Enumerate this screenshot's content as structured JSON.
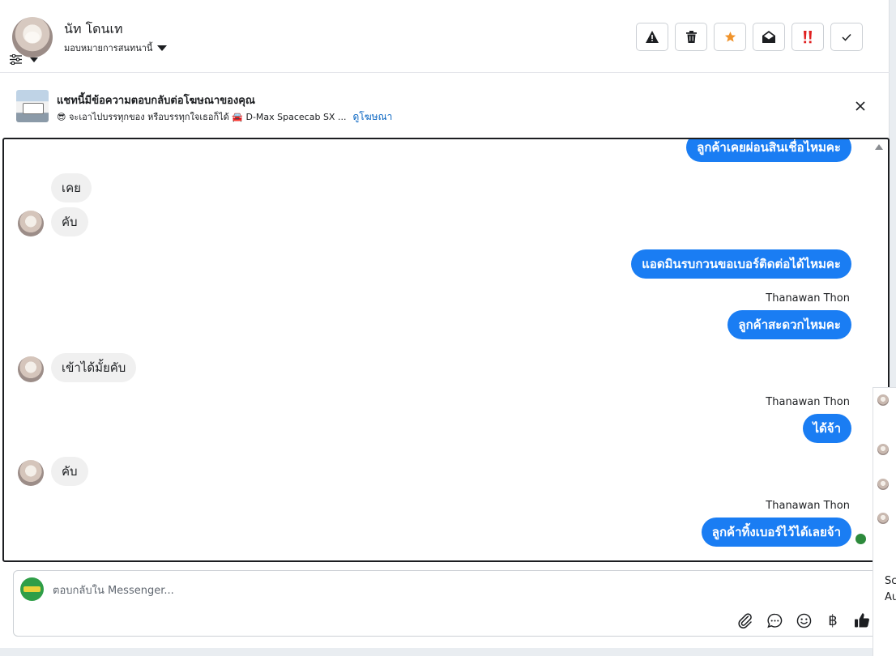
{
  "header": {
    "contact_name": "นัท โดนเท",
    "assign_label": "มอบหมายการสนทนานี้"
  },
  "toolbar": {
    "buttons": [
      {
        "name": "report-spam-button",
        "icon": "warning-icon"
      },
      {
        "name": "delete-button",
        "icon": "trash-icon"
      },
      {
        "name": "star-button",
        "icon": "star-icon"
      },
      {
        "name": "mark-unread-button",
        "icon": "open-envelope-icon"
      },
      {
        "name": "follow-up-button",
        "icon": "exclamation-icon"
      },
      {
        "name": "mark-done-button",
        "icon": "check-icon"
      }
    ]
  },
  "ad_banner": {
    "title": "แชทนี้มีข้อความตอบกลับต่อโฆษณาของคุณ",
    "subtitle": "😎 จะเอาไปบรรทุกของ หรือบรรทุกใจเธอก็ได้ 🚘 D-Max Spacecab SX ...",
    "link_label": "ดูโฆษณา"
  },
  "messages": [
    {
      "dir": "out",
      "text": "ลูกค้าเคยผ่อนสินเชื่อไหมคะ"
    },
    {
      "dir": "in",
      "text": "เคย"
    },
    {
      "dir": "in",
      "text": "คับ"
    },
    {
      "dir": "out",
      "text": "แอดมินรบกวนขอเบอร์ติดต่อได้ไหมคะ"
    },
    {
      "dir": "out",
      "sender": "Thanawan Thon",
      "text": "ลูกค้าสะดวกไหมคะ"
    },
    {
      "dir": "in",
      "text": "เข้าได้มั้ยคับ"
    },
    {
      "dir": "out",
      "sender": "Thanawan Thon",
      "text": "ได้จ้า"
    },
    {
      "dir": "in",
      "text": "คับ"
    },
    {
      "dir": "out",
      "sender": "Thanawan Thon",
      "text": "ลูกค้าทิ้งเบอร์ไว้ได้เลยจ้า"
    }
  ],
  "composer": {
    "placeholder": "ตอบกลับใน Messenger...",
    "currency_symbol": "฿"
  },
  "peek_panel": {
    "text_1": "Sc",
    "text_2": "Au"
  },
  "colors": {
    "outgoing_bubble": "#1a7df3",
    "incoming_bubble": "#f0f0f0",
    "star": "#f0932b",
    "follow_up": "#e02020",
    "link": "#0a66c2"
  }
}
